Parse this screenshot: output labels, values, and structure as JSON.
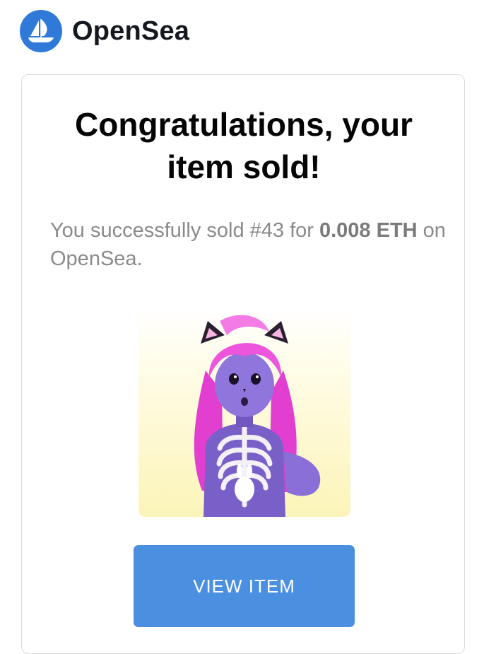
{
  "header": {
    "brand_name": "OpenSea",
    "logo_icon": "opensea-boat-icon"
  },
  "card": {
    "headline_line1": "Congratulations, your",
    "headline_line2": "item sold!",
    "message": {
      "prefix": "You successfully sold #43 for ",
      "amount": "0.008",
      "currency": "ETH",
      "suffix": " on OpenSea."
    },
    "item_image_icon": "nft-character-illustration",
    "view_button_label": "VIEW ITEM"
  },
  "colors": {
    "brand_blue": "#2f7ad8",
    "button_blue": "#4a8fe0",
    "muted_text": "#8a8a8a"
  }
}
